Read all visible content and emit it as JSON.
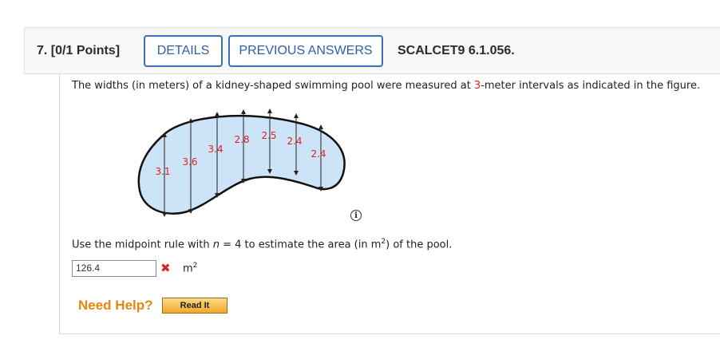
{
  "header": {
    "question_number": "7.",
    "points": "[0/1 Points]",
    "details_label": "DETAILS",
    "previous_answers_label": "PREVIOUS ANSWERS",
    "problem_code": "SCALCET9 6.1.056."
  },
  "prompt": {
    "before": "The widths (in meters) of a kidney-shaped swimming pool were measured at ",
    "interval": "3",
    "after": "-meter intervals as indicated in the figure."
  },
  "figure": {
    "widths": [
      "3.1",
      "3.6",
      "3.4",
      "2.8",
      "2.5",
      "2.4",
      "2.4"
    ],
    "label_color": "#e0201d",
    "pool_fill": "#cde3f7"
  },
  "question": {
    "before": "Use the midpoint rule with ",
    "var": "n",
    "eq": " = 4 to estimate the area (in m",
    "exp": "2",
    "after": ") of the pool."
  },
  "answer": {
    "value": "126.4",
    "status_icon": "x-mark",
    "unit": "m",
    "unit_exp": "2"
  },
  "help": {
    "label": "Need Help?",
    "read_it_label": "Read It"
  },
  "colors": {
    "button_border": "#3a6fbf",
    "button_text": "#2d5fa8",
    "help": "#e8850c",
    "wrong": "#d9252a"
  }
}
